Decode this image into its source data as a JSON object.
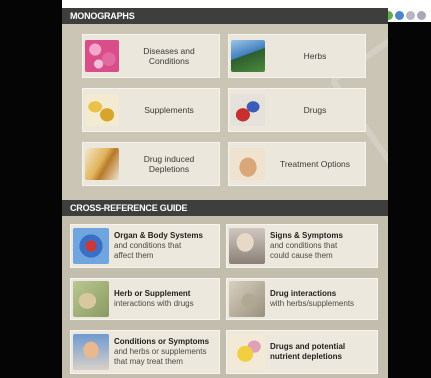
{
  "monographs": {
    "header": "MONOGRAPHS",
    "items": [
      {
        "label": "Diseases and\nConditions"
      },
      {
        "label": "Herbs"
      },
      {
        "label": "Supplements"
      },
      {
        "label": "Drugs"
      },
      {
        "label": "Drug induced\nDepletions"
      },
      {
        "label": "Treatment Options"
      }
    ]
  },
  "cross_reference": {
    "header": "CROSS-REFERENCE GUIDE",
    "items": [
      {
        "title": "Organ & Body Systems",
        "subtitle": "and conditions that\naffect them"
      },
      {
        "title": "Signs & Symptoms",
        "subtitle": "and conditions that\ncould cause them"
      },
      {
        "title": "Herb or Supplement",
        "subtitle": "interactions with drugs"
      },
      {
        "title": "Drug interactions",
        "subtitle": "with herbs/supplements"
      },
      {
        "title": "Conditions or Symptoms",
        "subtitle": "and herbs or supplements\nthat may treat them"
      },
      {
        "title": "Drugs and potential",
        "subtitle": "nutrient depletions"
      }
    ]
  },
  "colors": {
    "header_bg": "#3e3e3c",
    "section_bg": "#cbc5b6",
    "card_bg": "#ebe7dc"
  }
}
